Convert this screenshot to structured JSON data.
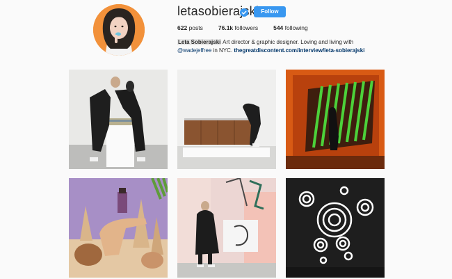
{
  "profile": {
    "username": "letasobierajski",
    "follow_label": "Follow",
    "posts_count": "622",
    "posts_label": "posts",
    "followers_count": "76.1k",
    "followers_label": "followers",
    "following_count": "544",
    "following_label": "following",
    "full_name": "Leta Sobierajski",
    "bio_text": " Art director & graphic designer. Loving and living with",
    "mention": "@wadejeffree",
    "bio_text2": " in NYC. ",
    "link": "thegreatdiscontent.com/interview/leta-sobierajski"
  },
  "colors": {
    "follow_button": "#3897f0",
    "avatar_bg": "#f2913a",
    "link": "#003569"
  },
  "icons": {
    "verified": "verified-badge-icon"
  }
}
